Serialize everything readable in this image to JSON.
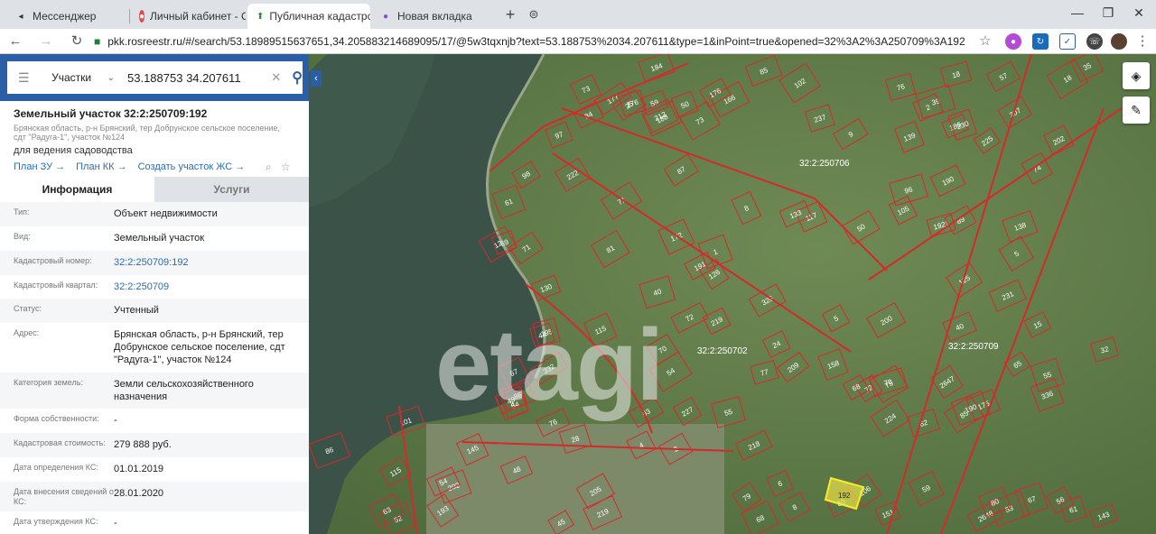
{
  "browser": {
    "tabs": [
      {
        "title": "Мессенджер",
        "icon": "vk-icon",
        "color": "#333"
      },
      {
        "title": "Личный кабинет - Соо",
        "icon": "red-circle-icon",
        "color": "#e24b4b"
      },
      {
        "title": "Публичная кадастрова",
        "icon": "rosreestr-icon",
        "color": "#2a8f3a"
      },
      {
        "title": "Новая вкладка",
        "icon": "purple-dot-icon",
        "color": "#8a4bd8"
      }
    ],
    "url": "pkk.rosreestr.ru/#/search/53.18989515637651,34.205883214689095/17/@5w3tqxnjb?text=53.188753%2034.207611&type=1&inPoint=true&opened=32%3A2%3A250709%3A192"
  },
  "search": {
    "type_label": "Участки",
    "query": "53.188753 34.207611"
  },
  "parcel": {
    "title": "Земельный участок 32:2:250709:192",
    "address_short": "Брянская область, р-н Брянский, тер Добрунское сельское поселение, сдт \"Радуга-1\", участок №124",
    "use": "для ведения садоводства",
    "links": [
      "План ЗУ →",
      "План КК →",
      "Создать участок ЖС →"
    ]
  },
  "panel_tabs": {
    "info": "Информация",
    "services": "Услуги"
  },
  "info_rows": [
    {
      "key": "Тип:",
      "value": "Объект недвижимости",
      "link": false
    },
    {
      "key": "Вид:",
      "value": "Земельный участок",
      "link": false
    },
    {
      "key": "Кадастровый номер:",
      "value": "32:2:250709:192",
      "link": true
    },
    {
      "key": "Кадастровый квартал:",
      "value": "32:2:250709",
      "link": true
    },
    {
      "key": "Статус:",
      "value": "Учтенный",
      "link": false
    },
    {
      "key": "Адрес:",
      "value": "Брянская область, р-н Брянский, тер Добрунское сельское поселение, сдт \"Радуга-1\", участок №124",
      "link": false
    },
    {
      "key": "Категория земель:",
      "value": "Земли сельскохозяйственного назначения",
      "link": false
    },
    {
      "key": "Форма собственности:",
      "value": "-",
      "link": false
    },
    {
      "key": "Кадастровая стоимость:",
      "value": "279 888 руб.",
      "link": false
    },
    {
      "key": "Дата определения КС:",
      "value": "01.01.2019",
      "link": false
    },
    {
      "key": "Дата внесения сведений о КС:",
      "value": "28.01.2020",
      "link": false
    },
    {
      "key": "Дата утверждения КС:",
      "value": "-",
      "link": false
    }
  ],
  "map": {
    "watermark": "etagi",
    "quarters": [
      "32:2:250706",
      "32:2:250702",
      "32:2:250709"
    ],
    "selected_parcel": "192",
    "parcel_labels": [
      "219",
      "166",
      "76",
      "67",
      "61",
      "77",
      "87",
      "1921",
      "48",
      "63",
      "50",
      "60",
      "2",
      "54",
      "53",
      "5",
      "12",
      "35",
      "52",
      "73",
      "75",
      "225",
      "218",
      "176",
      "186",
      "184",
      "205",
      "177",
      "172",
      "188",
      "55",
      "40",
      "68",
      "63",
      "62",
      "76",
      "9",
      "8",
      "3",
      "4",
      "15",
      "71",
      "72",
      "69",
      "57",
      "49",
      "67",
      "59",
      "8",
      "202",
      "195",
      "117",
      "175",
      "176",
      "59",
      "115",
      "219",
      "222",
      "209",
      "126",
      "54",
      "86",
      "6",
      "71",
      "72",
      "73",
      "79",
      "84",
      "28",
      "50",
      "190",
      "207",
      "2647",
      "227",
      "105",
      "85",
      "39",
      "61",
      "5",
      "40",
      "25",
      "32",
      "86",
      "65",
      "45",
      "24",
      "70",
      "68",
      "55",
      "74",
      "89",
      "56",
      "2648",
      "200",
      "190",
      "102",
      "191",
      "98",
      "130",
      "133",
      "80",
      "54",
      "158",
      "138",
      "336",
      "151",
      "143",
      "332",
      "230",
      "125",
      "139",
      "237",
      "326",
      "44",
      "81",
      "193",
      "212",
      "202",
      "85",
      "96",
      "106",
      "115",
      "97",
      "224",
      "231",
      "145",
      "101",
      "70",
      "1",
      "18",
      "18",
      "2"
    ]
  }
}
